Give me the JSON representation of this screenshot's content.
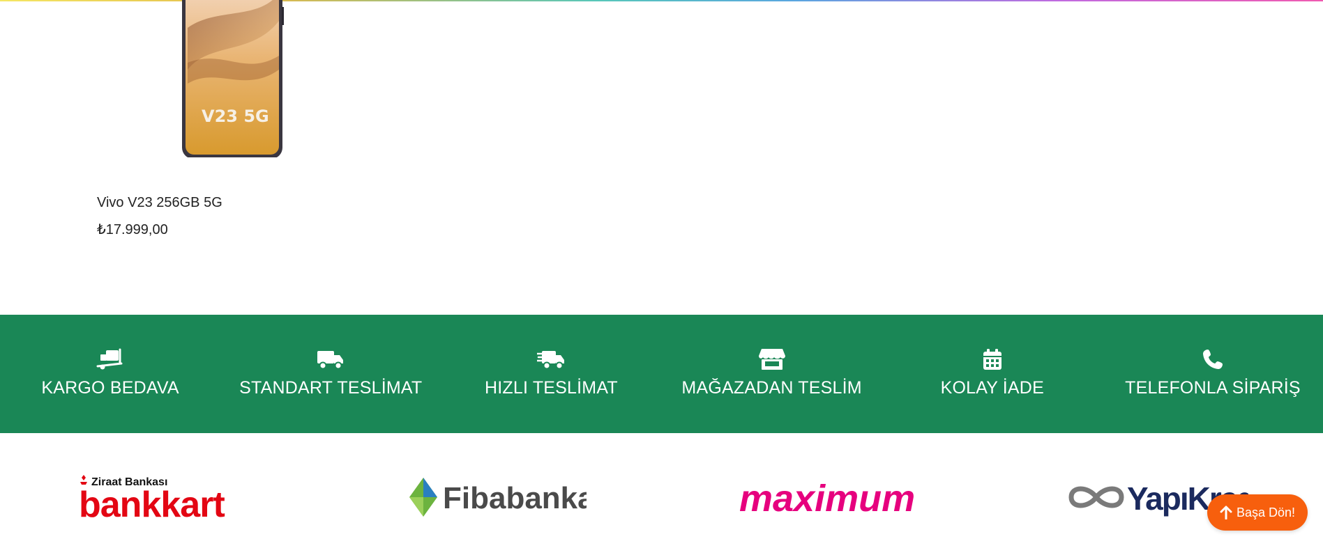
{
  "product": {
    "name": "Vivo V23 256GB 5G",
    "price": "₺17.999,00",
    "image_text": "V23 5G"
  },
  "features": [
    {
      "label": "KARGO BEDAVA",
      "icon": "hand-truck-icon"
    },
    {
      "label": "STANDART TESLİMAT",
      "icon": "truck-icon"
    },
    {
      "label": "HIZLI TESLİMAT",
      "icon": "fast-truck-icon"
    },
    {
      "label": "MAĞAZADAN TESLİM",
      "icon": "store-icon"
    },
    {
      "label": "KOLAY İADE",
      "icon": "calendar-icon"
    },
    {
      "label": "TELEFONLA SİPARİŞ",
      "icon": "phone-icon"
    }
  ],
  "banks": {
    "bankkart": {
      "top": "Ziraat Bankası",
      "main": "bankkart"
    },
    "fibabanka": {
      "main": "Fibabanka"
    },
    "maximum": {
      "main": "maximum"
    },
    "yapikredi": {
      "main": "YapıKredi"
    }
  },
  "back_to_top": {
    "label": "Başa Dön!"
  },
  "colors": {
    "feature_band": "#1a8756",
    "back_to_top": "#f75f0d",
    "ziraat_red": "#e30613",
    "maximum_pink": "#e6007e",
    "yapikredi_navy": "#1b2a5e"
  }
}
